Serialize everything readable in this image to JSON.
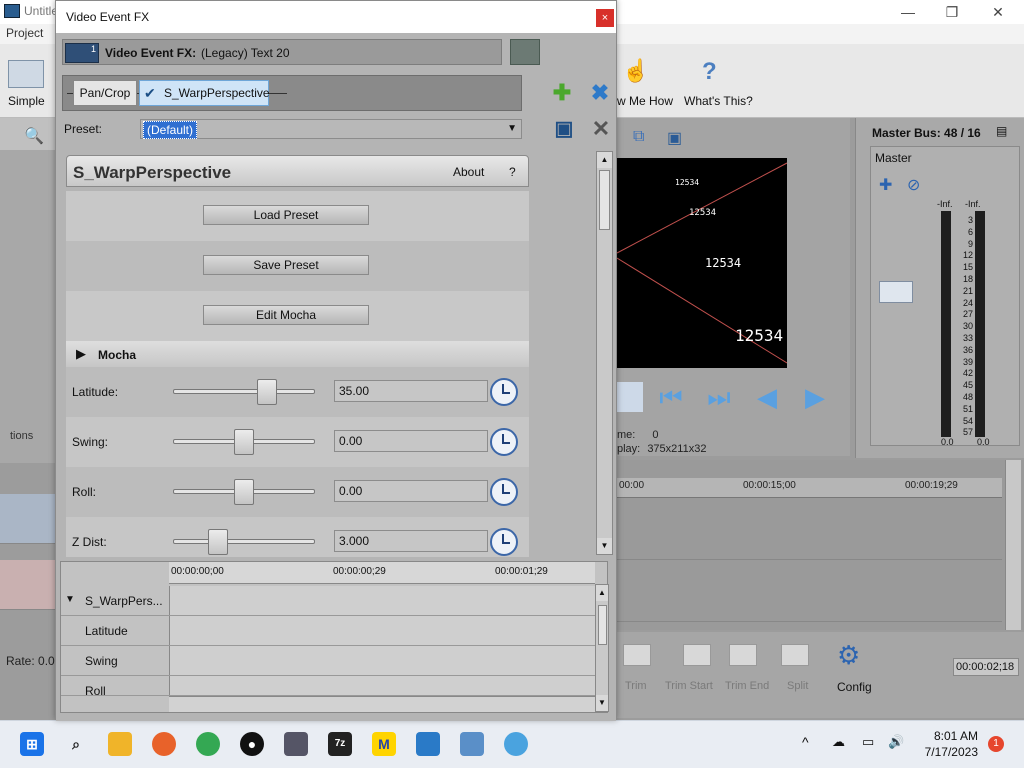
{
  "main_window": {
    "title": "Untitle",
    "menu": [
      "Project"
    ],
    "toolbar_left_label": "Simple",
    "show_me_how": "w Me How",
    "whats_this": "What's This?",
    "left_panel_text": "tions",
    "rate": "Rate: 0.00",
    "frame_label": "me:",
    "frame_value": "0",
    "display_label": "play:",
    "display_value": "375x211x32",
    "preview_texts": [
      "12534",
      "12534",
      "12534",
      "12534",
      "12534"
    ],
    "master": {
      "title": "Master Bus: 48 / 16",
      "label": "Master",
      "inf_left": "-Inf.",
      "inf_right": "-Inf.",
      "bottom_left": "0.0",
      "bottom_right": "0.0",
      "scale": [
        "3",
        "6",
        "9",
        "12",
        "15",
        "18",
        "21",
        "24",
        "27",
        "30",
        "33",
        "36",
        "39",
        "42",
        "45",
        "48",
        "51",
        "54",
        "57"
      ]
    },
    "timeline": {
      "ticks": [
        "00:00",
        "00:00:15;00",
        "00:00:19;29"
      ]
    },
    "bottom": {
      "labels": [
        "Trim",
        "Trim Start",
        "Trim End",
        "Split"
      ],
      "config": "Config",
      "timecode": "00:00:02;18"
    }
  },
  "dialog": {
    "title": "Video Event FX",
    "close": "×",
    "header_prefix": "Video Event FX:",
    "header_event": "(Legacy) Text 20",
    "badge": "1",
    "chain": [
      "Pan/Crop",
      "S_WarpPerspective"
    ],
    "preset_label": "Preset:",
    "preset_value": "(Default)",
    "plugin": {
      "name": "S_WarpPerspective",
      "about": "About",
      "help": "?",
      "buttons": [
        "Load Preset",
        "Save Preset",
        "Edit Mocha"
      ],
      "section": "Mocha",
      "params": [
        {
          "label": "Latitude:",
          "value": "35.00",
          "slider_pct": 0.69
        },
        {
          "label": "Swing:",
          "value": "0.00",
          "slider_pct": 0.5
        },
        {
          "label": "Roll:",
          "value": "0.00",
          "slider_pct": 0.5
        },
        {
          "label": "Z Dist:",
          "value": "3.000",
          "slider_pct": 0.29
        }
      ]
    },
    "keyframes": {
      "times": [
        "00:00:00;00",
        "00:00:00;29",
        "00:00:01;29"
      ],
      "rows": [
        "S_WarpPers...",
        "Latitude",
        "Swing",
        "Roll"
      ]
    }
  },
  "taskbar": {
    "time": "8:01 AM",
    "date": "7/17/2023",
    "notification_count": "1"
  }
}
